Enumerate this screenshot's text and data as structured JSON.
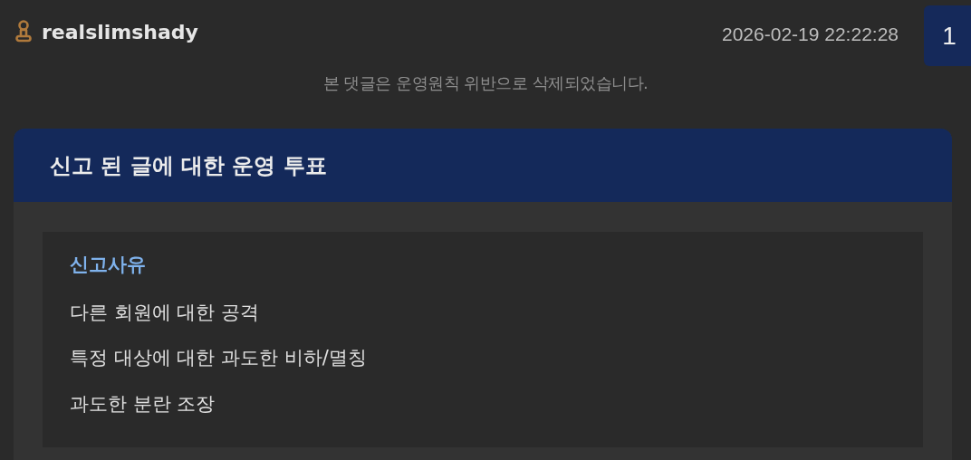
{
  "comment": {
    "author": "realslimshady",
    "timestamp": "2026-02-19 22:22:28",
    "number": "1",
    "deleted_notice": "본 댓글은 운영원칙 위반으로 삭제되었습니다."
  },
  "vote_panel": {
    "title": "신고 된 글에 대한 운영 투표",
    "reasons_heading": "신고사유",
    "reasons": [
      "다른 회원에 대한 공격",
      "특정 대상에 대한 과도한 비하/멸칭",
      "과도한 분란 조장"
    ]
  }
}
